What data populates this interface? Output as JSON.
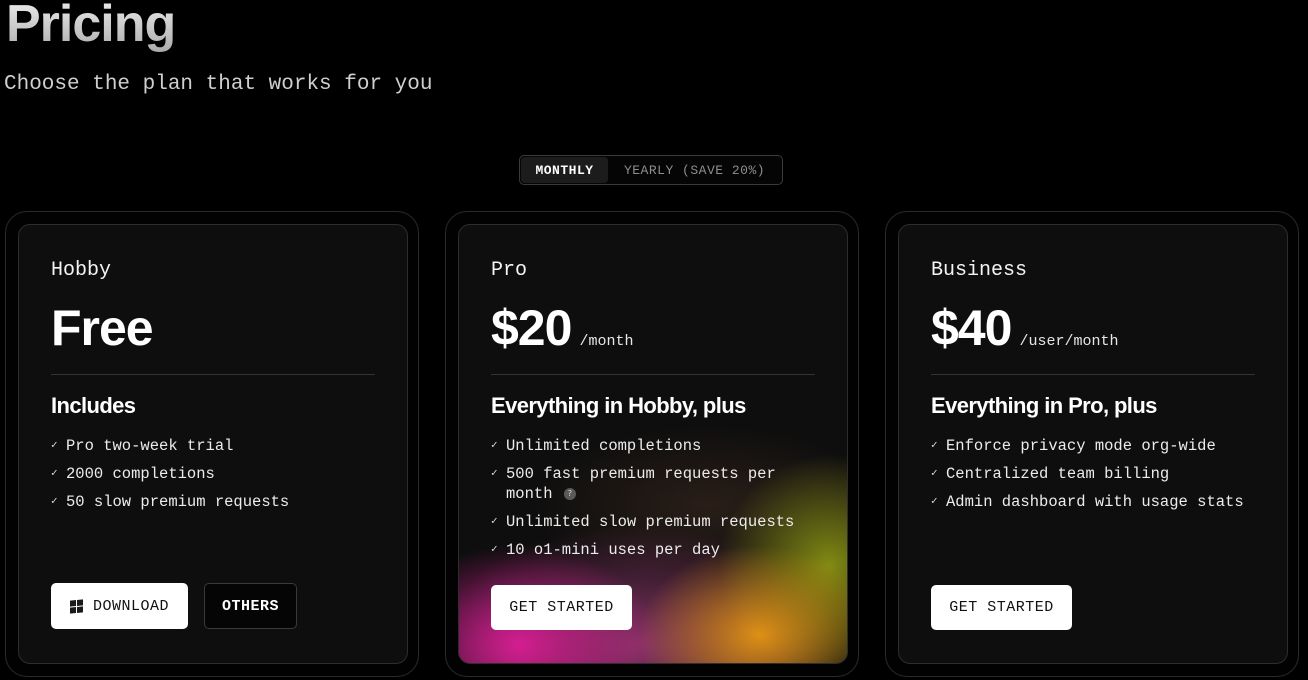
{
  "header": {
    "title": "Pricing",
    "subtitle": "Choose the plan that works for you"
  },
  "billing_toggle": {
    "monthly_label": "MONTHLY",
    "yearly_label": "YEARLY (SAVE 20%)",
    "selected": "MONTHLY"
  },
  "plans": [
    {
      "name": "Hobby",
      "price": "Free",
      "price_unit": "",
      "features_heading": "Includes",
      "features": [
        "Pro two-week trial",
        "2000 completions",
        "50 slow premium requests"
      ],
      "buttons": {
        "download_label": "DOWNLOAD",
        "others_label": "OTHERS"
      }
    },
    {
      "name": "Pro",
      "price": "$20",
      "price_unit": "/month",
      "features_heading": "Everything in Hobby, plus",
      "features": [
        "Unlimited completions",
        "500 fast premium requests per month",
        "Unlimited slow premium requests",
        "10 o1-mini uses per day"
      ],
      "info_icon_glyph": "?",
      "cta_label": "GET STARTED"
    },
    {
      "name": "Business",
      "price": "$40",
      "price_unit": "/user/month",
      "features_heading": "Everything in Pro, plus",
      "features": [
        "Enforce privacy mode org-wide",
        "Centralized team billing",
        "Admin dashboard with usage stats"
      ],
      "cta_label": "GET STARTED"
    }
  ],
  "icons": {
    "check": "✓",
    "windows": "windows-logo-icon",
    "info": "question-info-icon"
  },
  "colors": {
    "background": "#000000",
    "card_background": "#0e0e0e",
    "button_light": "#ffffff",
    "pro_gradient_pink": "#dc1e96",
    "pro_gradient_orange": "#e69614",
    "pro_gradient_olive": "#96a014"
  }
}
